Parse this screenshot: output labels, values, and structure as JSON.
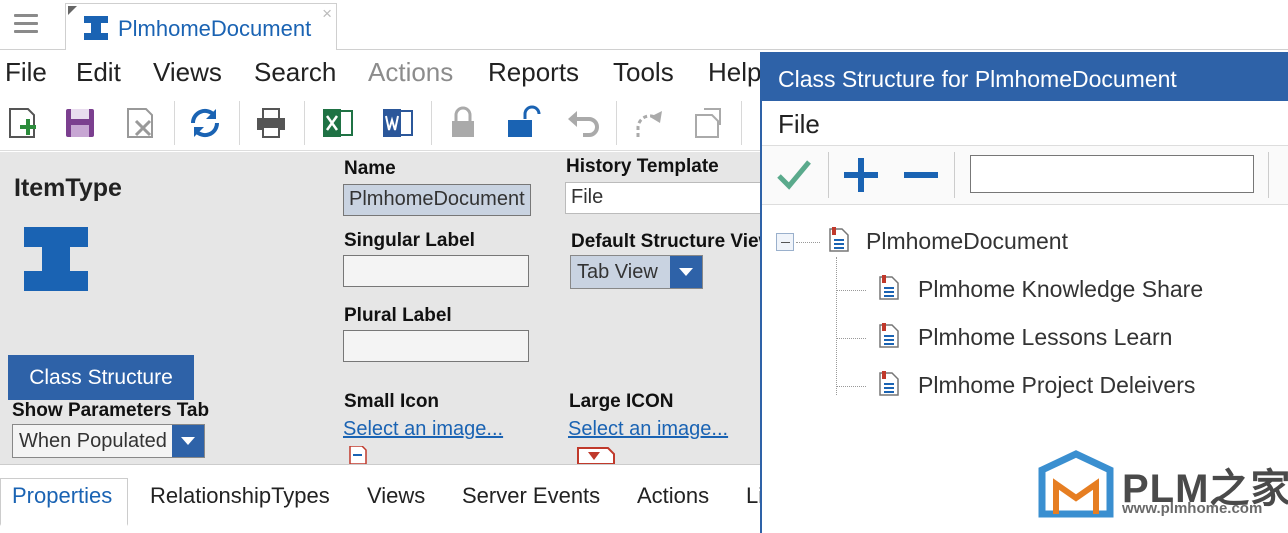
{
  "tab": {
    "title": "PlmhomeDocument",
    "close": "×"
  },
  "menubar": {
    "file": "File",
    "edit": "Edit",
    "views": "Views",
    "search": "Search",
    "actions": "Actions",
    "reports": "Reports",
    "tools": "Tools",
    "help": "Help"
  },
  "toolbar_icons": [
    "new-item",
    "save",
    "discard",
    "refresh",
    "print",
    "export-excel",
    "export-word",
    "lock",
    "unlock",
    "undo",
    "redo",
    "new-version"
  ],
  "form": {
    "itemtype_title": "ItemType",
    "name_label": "Name",
    "name_value": "PlmhomeDocument",
    "singular_label": "Singular Label",
    "singular_value": "",
    "plural_label": "Plural Label",
    "plural_value": "",
    "history_label": "History Template",
    "history_value": "File",
    "default_structure_label": "Default Structure View",
    "default_structure_value": "Tab View",
    "class_structure_button": "Class Structure",
    "show_params_label": "Show Parameters Tab",
    "show_params_value": "When Populated",
    "small_icon_label": "Small Icon",
    "small_icon_link": "Select an image...",
    "large_icon_label": "Large ICON",
    "large_icon_link": "Select an image..."
  },
  "bottom_tabs": [
    "Properties",
    "RelationshipTypes",
    "Views",
    "Server Events",
    "Actions",
    "Li"
  ],
  "panel": {
    "title": "Class Structure for PlmhomeDocument",
    "menu_file": "File",
    "search_value": "",
    "tree": {
      "root": "PlmhomeDocument",
      "children": [
        "Plmhome Knowledge Share",
        "Plmhome Lessons Learn",
        "Plmhome Project Deleivers"
      ]
    }
  },
  "watermark": {
    "brand": "PLM之家",
    "url": "www.plmhome.com"
  },
  "colors": {
    "accent": "#2e62a8",
    "link": "#1a63b3",
    "form_bg": "#e6e6e6",
    "check": "#5aaa8c"
  }
}
